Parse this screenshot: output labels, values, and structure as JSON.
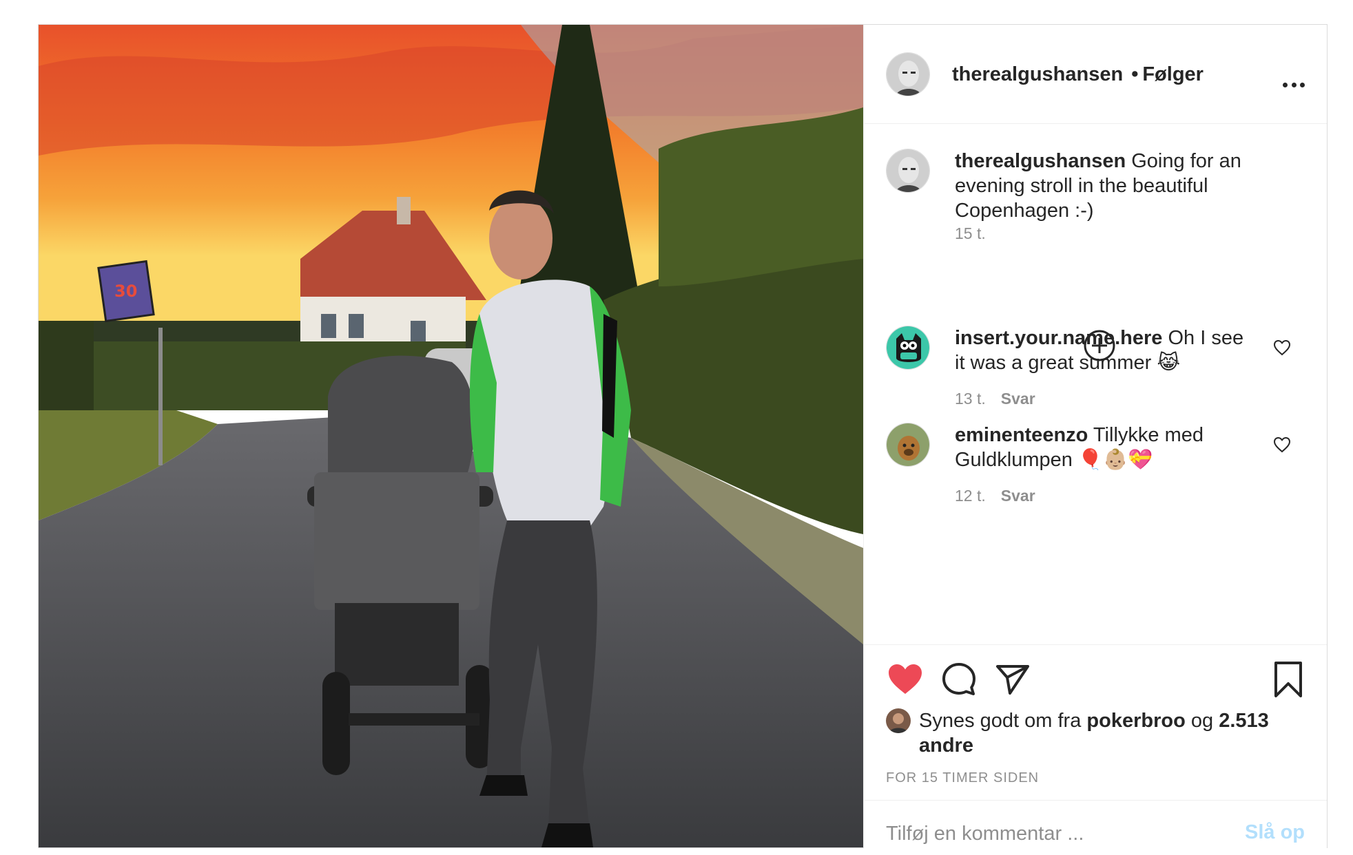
{
  "post": {
    "author": {
      "username": "therealgushansen",
      "separator": "•",
      "follow_label": "Følger"
    },
    "photo": {
      "sign_text": "30"
    },
    "caption": {
      "username": "therealgushansen",
      "text": "Going for an evening stroll in the beautiful Copenhagen :-)",
      "time": "15 t."
    },
    "comments": [
      {
        "username": "insert.your.name.here",
        "text": "Oh I see it was a great summer 😹",
        "time": "13 t.",
        "reply_label": "Svar"
      },
      {
        "username": "eminenteenzo",
        "text": "Tillykke med Guldklumpen 🎈👶🏼💝",
        "time": "12 t.",
        "reply_label": "Svar"
      }
    ],
    "likes": {
      "prefix": "Synes godt om fra",
      "first_user": "pokerbroo",
      "joiner": "og",
      "others": "2.513 andre"
    },
    "timestamp": "FOR 15 TIMER SIDEN",
    "add_comment": {
      "placeholder": "Tilføj en kommentar ...",
      "post_label": "Slå op"
    },
    "icons": {
      "like": "heart-filled-icon",
      "comment": "comment-bubble-icon",
      "share": "paper-plane-icon",
      "save": "bookmark-icon",
      "more": "more-options-icon",
      "load_more": "plus-circle-icon"
    },
    "colors": {
      "like_red": "#ed4956",
      "post_button": "#b2dffc",
      "secondary_text": "#8e8e8e"
    }
  }
}
